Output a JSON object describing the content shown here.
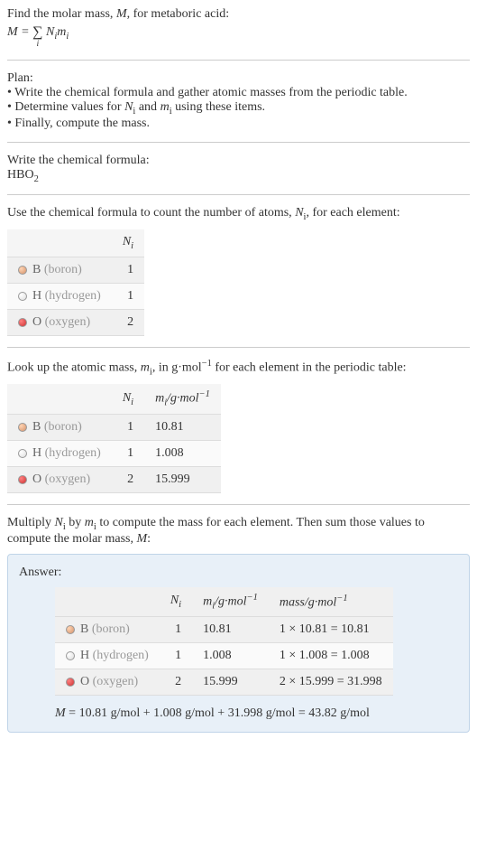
{
  "intro": {
    "line1": "Find the molar mass, ",
    "line1_var": "M",
    "line1_end": ", for metaboric acid:",
    "formula_lhs": "M",
    "formula_eq": " = ",
    "sigma": "∑",
    "sigma_sub": "i",
    "formula_rhs1": "N",
    "formula_rhs1_sub": "i",
    "formula_rhs2": "m",
    "formula_rhs2_sub": "i"
  },
  "plan": {
    "heading": "Plan:",
    "bullet1": "• Write the chemical formula and gather atomic masses from the periodic table.",
    "bullet2_start": "• Determine values for ",
    "bullet2_n": "N",
    "bullet2_nsub": "i",
    "bullet2_and": " and ",
    "bullet2_m": "m",
    "bullet2_msub": "i",
    "bullet2_end": " using these items.",
    "bullet3": "• Finally, compute the mass."
  },
  "chemformula": {
    "heading": "Write the chemical formula:",
    "formula": "HBO",
    "formula_sub": "2"
  },
  "count": {
    "heading_start": "Use the chemical formula to count the number of atoms, ",
    "heading_n": "N",
    "heading_nsub": "i",
    "heading_end": ", for each element:",
    "col_n": "N",
    "col_n_sub": "i"
  },
  "elements": [
    {
      "symbol": "B",
      "name": "(boron)",
      "dot": "dot-boron",
      "n": "1",
      "m": "10.81",
      "mass": "1 × 10.81 = 10.81"
    },
    {
      "symbol": "H",
      "name": "(hydrogen)",
      "dot": "dot-hydrogen",
      "n": "1",
      "m": "1.008",
      "mass": "1 × 1.008 = 1.008"
    },
    {
      "symbol": "O",
      "name": "(oxygen)",
      "dot": "dot-oxygen",
      "n": "2",
      "m": "15.999",
      "mass": "2 × 15.999 = 31.998"
    }
  ],
  "lookup": {
    "heading_start": "Look up the atomic mass, ",
    "heading_m": "m",
    "heading_msub": "i",
    "heading_mid": ", in g·mol",
    "heading_sup": "−1",
    "heading_end": " for each element in the periodic table:",
    "col_m": "m",
    "col_m_sub": "i",
    "col_m_unit": "/g·mol",
    "col_m_sup": "−1"
  },
  "multiply": {
    "heading_start": "Multiply ",
    "heading_n": "N",
    "heading_nsub": "i",
    "heading_by": " by ",
    "heading_m": "m",
    "heading_msub": "i",
    "heading_end": " to compute the mass for each element. Then sum those values to compute the molar mass, ",
    "heading_mvar": "M",
    "heading_colon": ":"
  },
  "answer": {
    "label": "Answer:",
    "col_mass": "mass/g·mol",
    "col_mass_sup": "−1",
    "final_m": "M",
    "final_eq": " = 10.81 g/mol + 1.008 g/mol + 31.998 g/mol = 43.82 g/mol"
  }
}
